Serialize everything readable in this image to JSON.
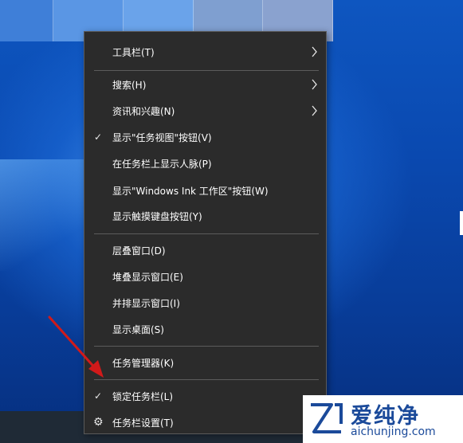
{
  "menu": {
    "items": [
      {
        "id": "toolbars",
        "label": "工具栏(T)",
        "submenu": true,
        "checked": false
      },
      {
        "id": "search",
        "label": "搜索(H)",
        "submenu": true,
        "checked": false
      },
      {
        "id": "news",
        "label": "资讯和兴趣(N)",
        "submenu": true,
        "checked": false
      },
      {
        "id": "task-view",
        "label": "显示\"任务视图\"按钮(V)",
        "submenu": false,
        "checked": true
      },
      {
        "id": "people",
        "label": "在任务栏上显示人脉(P)",
        "submenu": false,
        "checked": false
      },
      {
        "id": "ink",
        "label": "显示\"Windows Ink 工作区\"按钮(W)",
        "submenu": false,
        "checked": false
      },
      {
        "id": "touch-keyboard",
        "label": "显示触摸键盘按钮(Y)",
        "submenu": false,
        "checked": false
      },
      {
        "id": "cascade",
        "label": "层叠窗口(D)",
        "submenu": false,
        "checked": false
      },
      {
        "id": "stacked",
        "label": "堆叠显示窗口(E)",
        "submenu": false,
        "checked": false
      },
      {
        "id": "side-by-side",
        "label": "并排显示窗口(I)",
        "submenu": false,
        "checked": false
      },
      {
        "id": "show-desktop",
        "label": "显示桌面(S)",
        "submenu": false,
        "checked": false
      },
      {
        "id": "task-manager",
        "label": "任务管理器(K)",
        "submenu": false,
        "checked": false
      },
      {
        "id": "lock-taskbar",
        "label": "锁定任务栏(L)",
        "submenu": false,
        "checked": true
      },
      {
        "id": "taskbar-settings",
        "label": "任务栏设置(T)",
        "submenu": false,
        "checked": false,
        "icon": "gear-icon"
      }
    ]
  },
  "watermark": {
    "title": "爱纯净",
    "url": "aichunjing.com"
  },
  "colors": {
    "menu_bg": "#2b2b2b",
    "annotation_arrow": "#d11a1a",
    "watermark_blue": "#1b4a9a"
  }
}
